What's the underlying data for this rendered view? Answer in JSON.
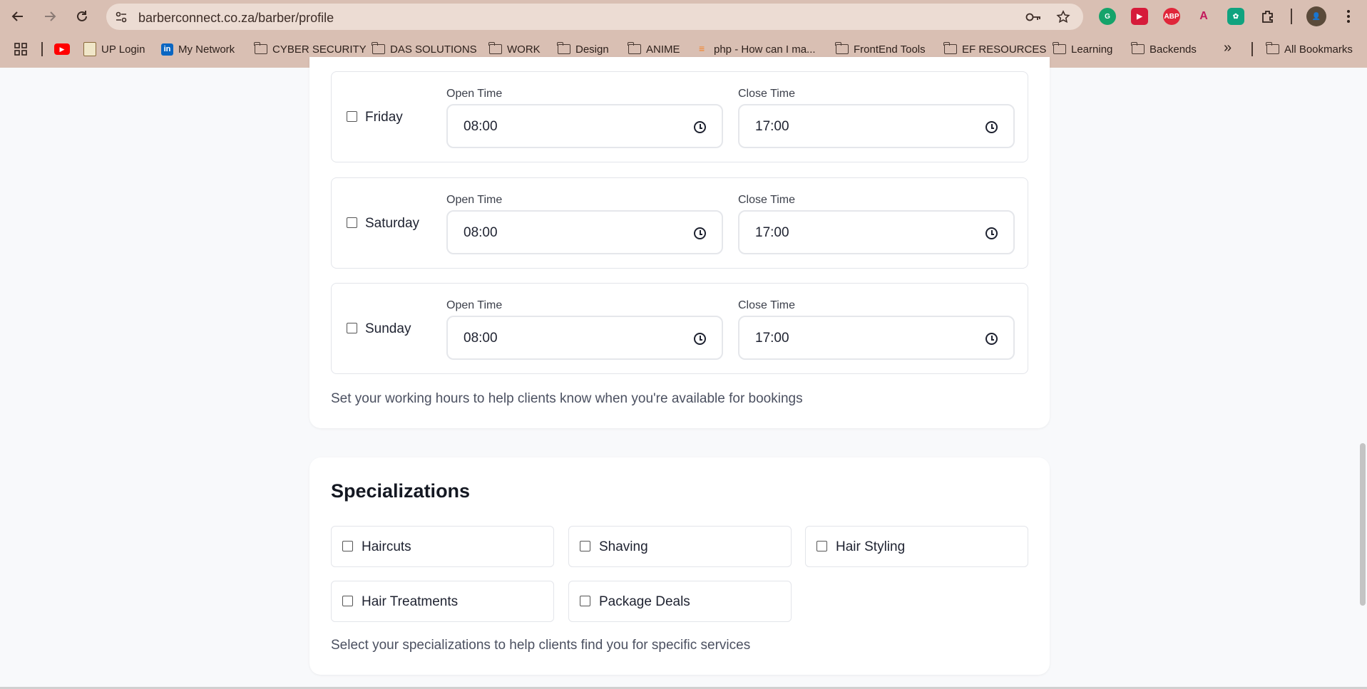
{
  "browser": {
    "url": "barberconnect.co.za/barber/profile",
    "bookmarks": [
      {
        "label": "UP Login"
      },
      {
        "label": "My Network"
      },
      {
        "label": "CYBER SECURITY"
      },
      {
        "label": "DAS SOLUTIONS"
      },
      {
        "label": "WORK"
      },
      {
        "label": "Design"
      },
      {
        "label": "ANIME"
      },
      {
        "label": "php - How can I ma..."
      },
      {
        "label": "FrontEnd Tools"
      },
      {
        "label": "EF RESOURCES"
      },
      {
        "label": "Learning"
      },
      {
        "label": "Backends"
      }
    ],
    "all_bookmarks": "All Bookmarks",
    "overflow": "»",
    "extensions": [
      "grammarly-icon",
      "video-speed-icon",
      "adblock-icon",
      "angular-icon",
      "chatgpt-icon",
      "puzzle-icon",
      "profile-avatar"
    ]
  },
  "hours": {
    "open_label": "Open Time",
    "close_label": "Close Time",
    "days": [
      {
        "day": "Friday",
        "checked": false,
        "open": "08:00",
        "close": "17:00"
      },
      {
        "day": "Saturday",
        "checked": false,
        "open": "08:00",
        "close": "17:00"
      },
      {
        "day": "Sunday",
        "checked": false,
        "open": "08:00",
        "close": "17:00"
      }
    ],
    "hint": "Set your working hours to help clients know when you're available for bookings"
  },
  "specializations": {
    "title": "Specializations",
    "items": [
      {
        "label": "Haircuts",
        "checked": false
      },
      {
        "label": "Shaving",
        "checked": false
      },
      {
        "label": "Hair Styling",
        "checked": false
      },
      {
        "label": "Hair Treatments",
        "checked": false
      },
      {
        "label": "Package Deals",
        "checked": false
      }
    ],
    "hint": "Select your specializations to help clients find you for specific services"
  },
  "colors": {
    "chrome": "#d9bfb3",
    "page_bg": "#f8f9fb",
    "card_bg": "#ffffff",
    "text": "#1e2230"
  }
}
